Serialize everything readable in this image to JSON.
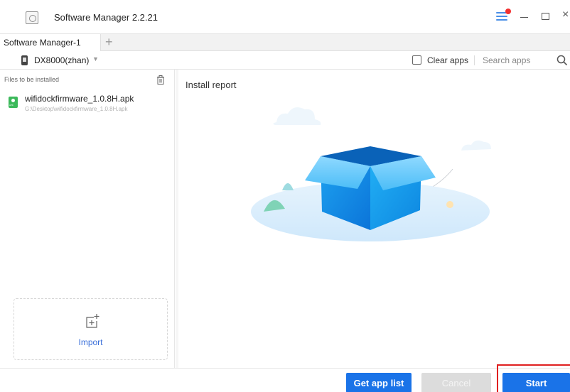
{
  "window": {
    "title": "Software Manager 2.2.21"
  },
  "tabs": [
    {
      "label": "Software Manager-1"
    }
  ],
  "toolbar": {
    "device_name": "DX8000(zhan)",
    "clear_apps_label": "Clear apps",
    "clear_apps_checked": false,
    "search_placeholder": "Search apps"
  },
  "files_panel": {
    "header": "Files to be installed",
    "files": [
      {
        "name": "wifidockfirmware_1.0.8H.apk",
        "path": "G:\\Desktop\\wifidockfirmware_1.0.8H.apk"
      }
    ],
    "import_label": "Import"
  },
  "report": {
    "title": "Install report"
  },
  "footer": {
    "get_app_list_label": "Get app list",
    "cancel_label": "Cancel",
    "start_label": "Start"
  },
  "colors": {
    "primary": "#1a73e8",
    "disabled": "#dcdcdc",
    "highlight_frame": "#e02020",
    "notification_dot": "#f23030",
    "apk_icon": "#3cb95b"
  },
  "icons": {
    "app_logo": "app-logo-icon",
    "menu": "menu-icon",
    "minimize": "minimize-icon",
    "maximize": "maximize-icon",
    "close": "close-icon",
    "add_tab": "plus-icon",
    "device": "phone-icon",
    "dropdown": "chevron-down-icon",
    "search": "search-icon",
    "trash": "trash-icon",
    "apk": "apk-file-icon",
    "import": "import-icon"
  }
}
